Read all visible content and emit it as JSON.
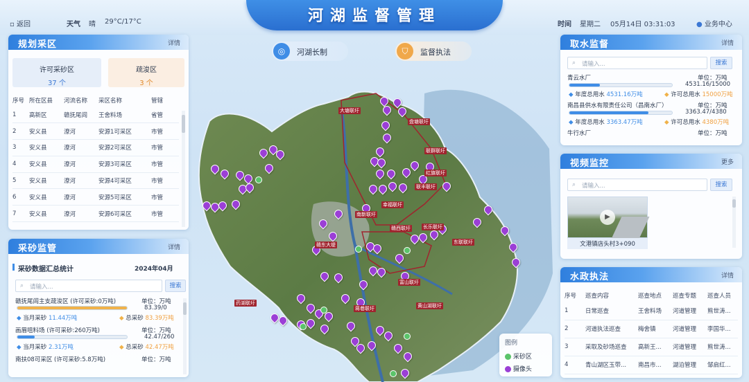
{
  "header": {
    "back": "返回",
    "weather_label": "天气",
    "weather": "晴",
    "temp": "29°C/17°C",
    "title": "河湖监督管理",
    "time_label": "时间",
    "weekday": "星期二",
    "datetime": "05月14日 03:31:03",
    "business": "业务中心"
  },
  "tabs": [
    {
      "label": "河湖长制"
    },
    {
      "label": "监督执法"
    }
  ],
  "plan": {
    "title": "规划采区",
    "more": "详情",
    "stat1_label": "许可采砂区",
    "stat1_value": "37",
    "stat1_unit": "个",
    "stat2_label": "疏浚区",
    "stat2_value": "3",
    "stat2_unit": "个",
    "columns": [
      "序号",
      "所在区县",
      "河流名称",
      "采区名称",
      "管辖"
    ],
    "rows": [
      [
        "1",
        "高新区",
        "赣抚尾闾",
        "王舍料场",
        "省管"
      ],
      [
        "2",
        "安义县",
        "潦河",
        "安源1可采区",
        "市管"
      ],
      [
        "3",
        "安义县",
        "潦河",
        "安源2可采区",
        "市管"
      ],
      [
        "4",
        "安义县",
        "潦河",
        "安源3可采区",
        "市管"
      ],
      [
        "5",
        "安义县",
        "潦河",
        "安源4可采区",
        "市管"
      ],
      [
        "6",
        "安义县",
        "潦河",
        "安源5可采区",
        "市管"
      ],
      [
        "7",
        "安义县",
        "潦河",
        "安源6可采区",
        "市管"
      ]
    ]
  },
  "mining": {
    "title": "采砂监管",
    "more": "详情",
    "sub": "采砂数据汇总统计",
    "month": "2024年04月",
    "search_placeholder": "请输入...",
    "search_btn": "搜索",
    "items": [
      {
        "name": "赣抚尾闾主支疏浚区 (许可采砂:0万吨)",
        "unit": "单位：万吨",
        "ratio": "83.39/0",
        "fill": 1.0,
        "color": "#f0b24a",
        "cur_label": "当月采砂",
        "cur": "11.44万吨",
        "tot_label": "总采砂",
        "tot": "83.39万吨"
      },
      {
        "name": "画眉咀料场 (许可采砂:260万吨)",
        "unit": "单位：万吨",
        "ratio": "42.47/260",
        "fill": 0.16,
        "color": "#3f8de6",
        "cur_label": "当月采砂",
        "cur": "2.31万吨",
        "tot_label": "总采砂",
        "tot": "42.47万吨"
      },
      {
        "name": "南扶08可采区 (许可采砂:5.8万吨)",
        "unit": "单位：万吨",
        "ratio": "",
        "fill": 0,
        "color": "#3f8de6"
      }
    ]
  },
  "water": {
    "title": "取水监督",
    "more": "详情",
    "search_placeholder": "请输入...",
    "search_btn": "搜索",
    "items": [
      {
        "name": "青云水厂",
        "unit": "单位：万吨",
        "ratio": "4531.16/15000",
        "fill": 0.3,
        "year_label": "年度总用水",
        "year": "4531.16万吨",
        "perm_label": "许可总用水",
        "perm": "15000万吨"
      },
      {
        "name": "南昌县供水有限责任公司（昌南水厂）",
        "unit": "单位：万吨",
        "ratio": "3363.47/4380",
        "fill": 0.77,
        "year_label": "年度总用水",
        "year": "3363.47万吨",
        "perm_label": "许可总用水",
        "perm": "4380万吨"
      },
      {
        "name": "牛行水厂",
        "unit": "单位：万吨",
        "ratio": "",
        "fill": 0
      }
    ]
  },
  "video": {
    "title": "视频监控",
    "more": "更多",
    "search_placeholder": "请输入...",
    "search_btn": "搜索",
    "caption": "文港镇店头村3+090"
  },
  "enforce": {
    "title": "水政执法",
    "more": "详情",
    "columns": [
      "序号",
      "巡查内容",
      "巡查地点",
      "巡查专题",
      "巡查人员"
    ],
    "rows": [
      [
        "1",
        "日常巡查",
        "王舍料场",
        "河道管理",
        "熊世涛..."
      ],
      [
        "2",
        "河道执法巡查",
        "梅舍镇",
        "河道管理",
        "李国华..."
      ],
      [
        "3",
        "采取及砂场巡查",
        "高新王...",
        "河道管理",
        "熊世涛..."
      ],
      [
        "4",
        "青山湖区玉带...",
        "南昌市...",
        "湖泊管理",
        "邹启红..."
      ]
    ]
  },
  "legend": {
    "title": "图例",
    "items": [
      {
        "label": "采砂区",
        "color": "#5bc46a"
      },
      {
        "label": "摄像头",
        "color": "#9b3fd6"
      }
    ]
  },
  "map_labels": [
    "大塘联圩",
    "盘塘联圩",
    "联群联圩",
    "赣西联圩",
    "红旗联圩",
    "联丰联圩",
    "东联联圩",
    "长乐联圩",
    "南新联圩",
    "幸福联圩",
    "赣东大堤",
    "富山联圩",
    "蒋巷联圩",
    "黄山湖联圩",
    "药湖联圩"
  ]
}
